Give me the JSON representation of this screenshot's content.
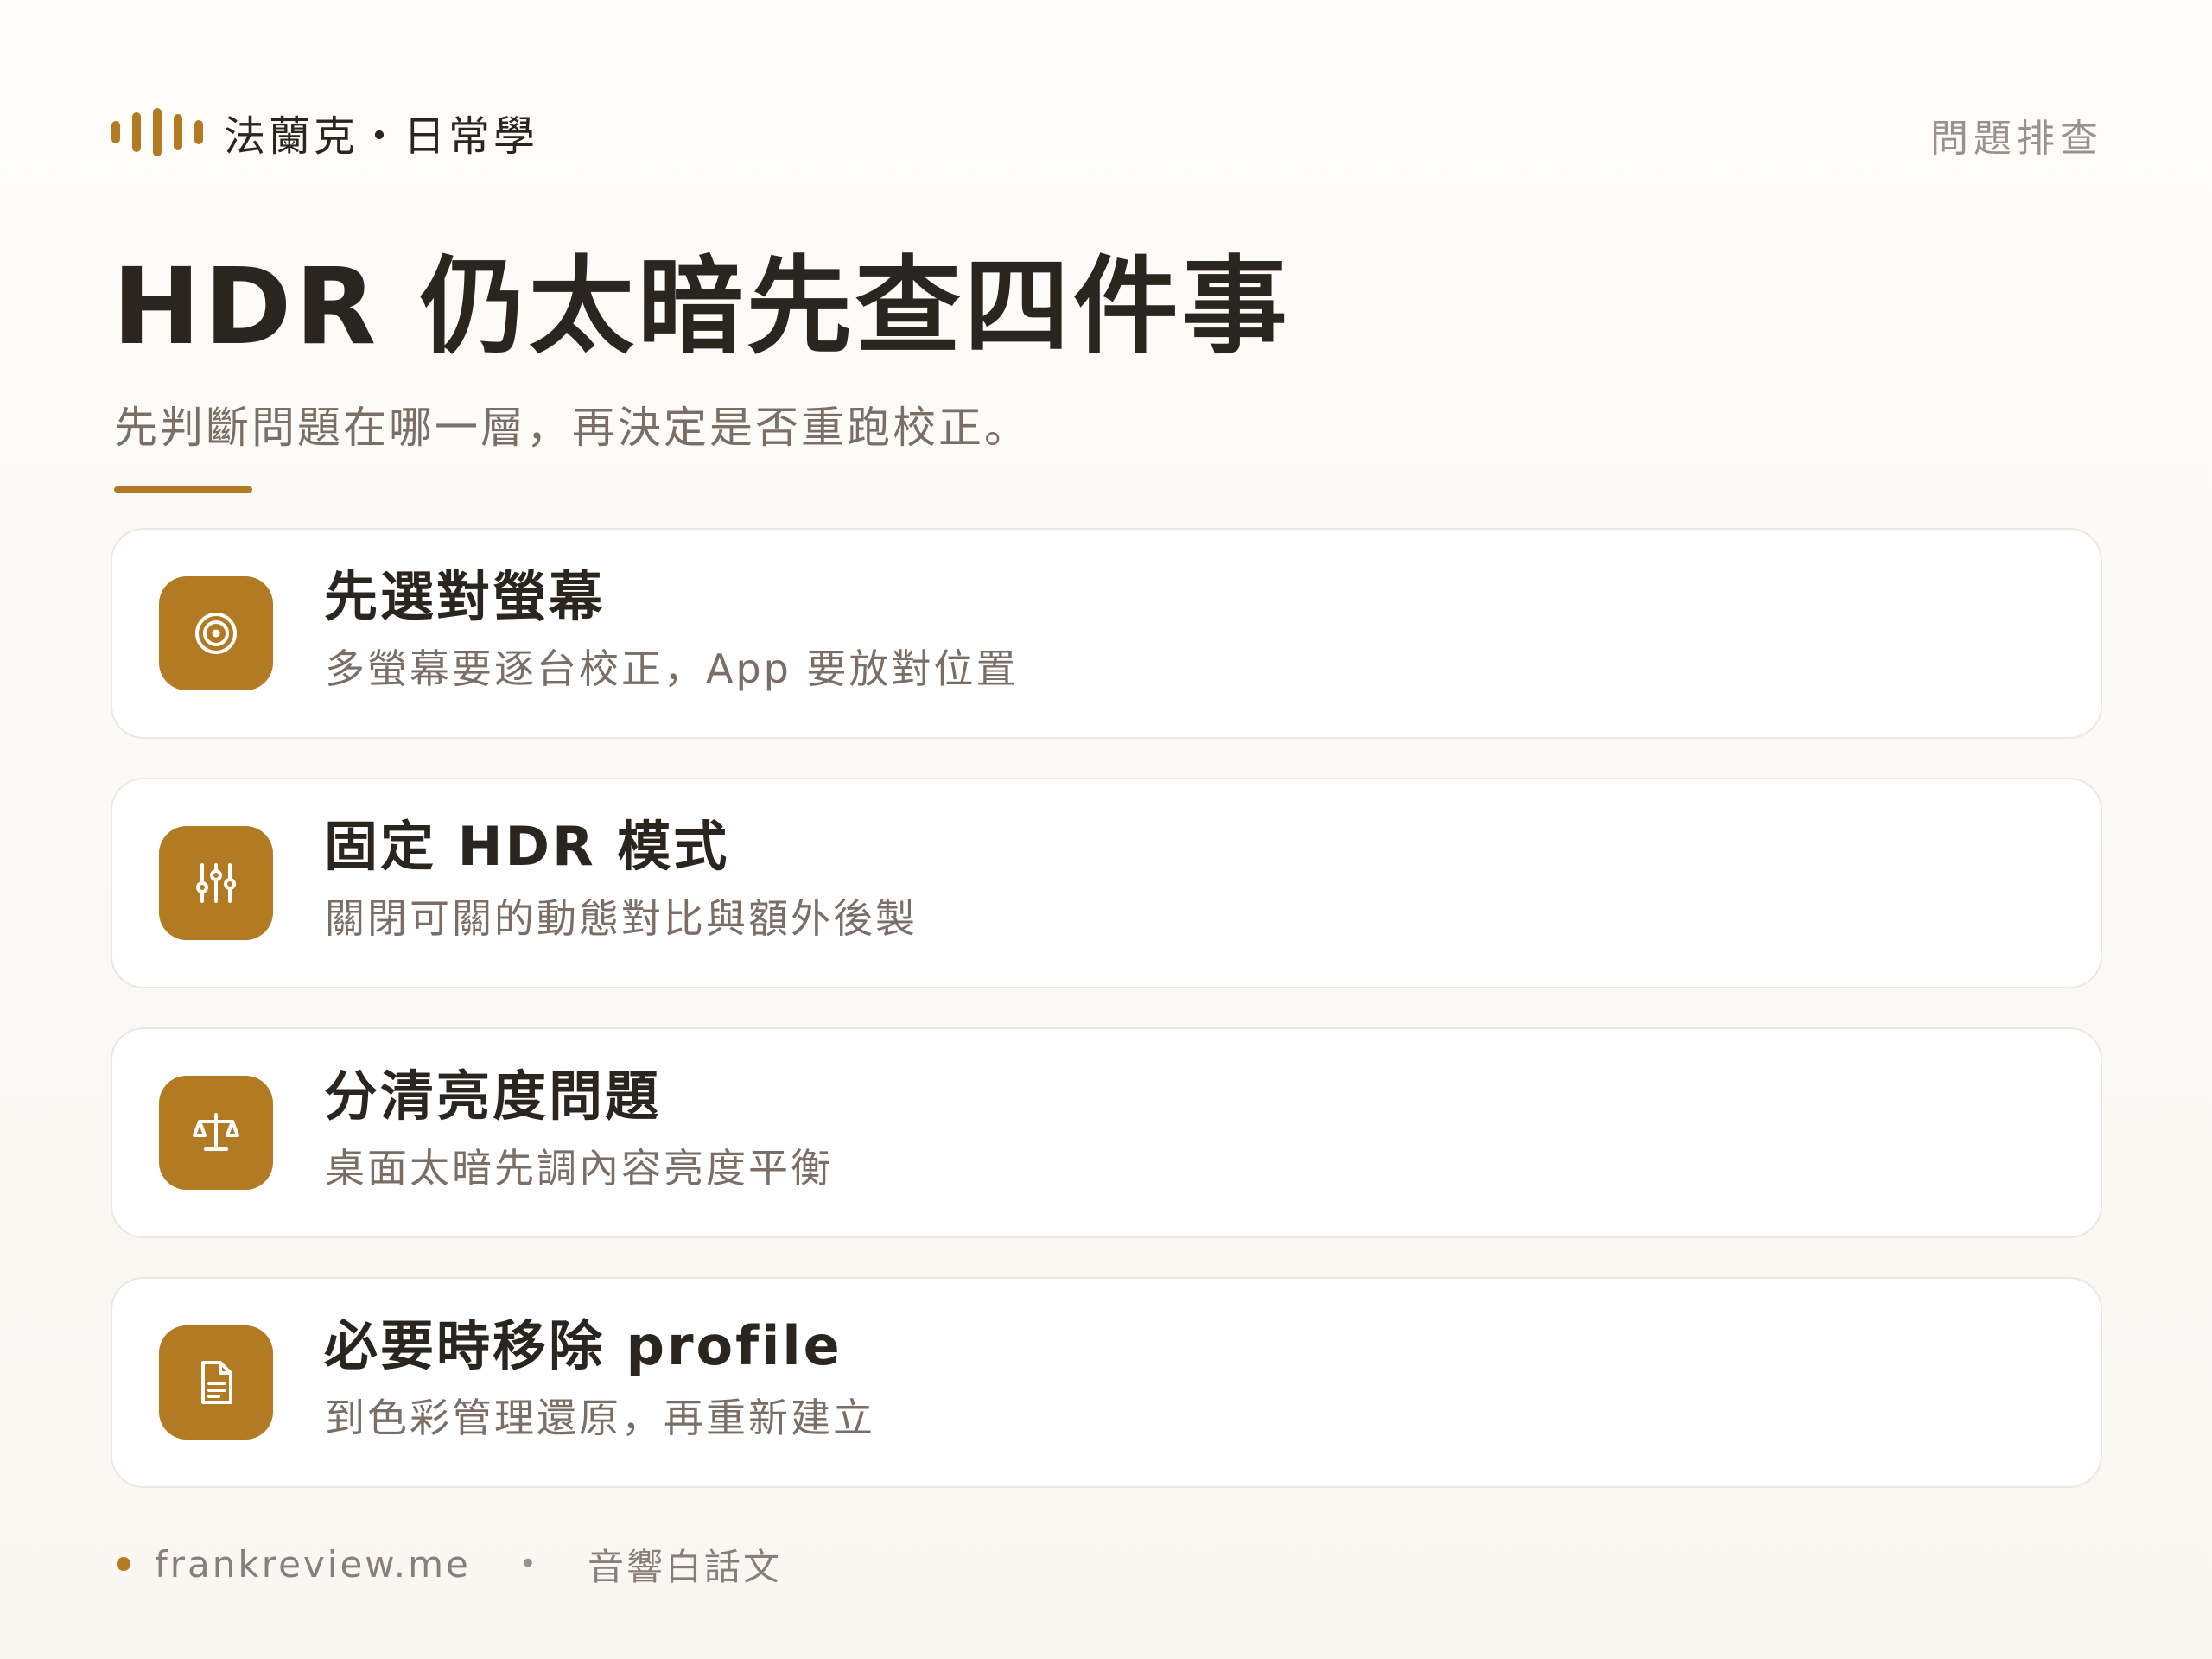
{
  "header": {
    "brand": "法蘭克・日常學",
    "brand_icon": "sound-wave-icon",
    "tag": "問題排查"
  },
  "main": {
    "title": "HDR 仍太暗先查四件事",
    "subtitle": "先判斷問題在哪一層，再決定是否重跑校正。",
    "cards": [
      {
        "icon": "target-icon",
        "title": "先選對螢幕",
        "desc": "多螢幕要逐台校正，App 要放對位置"
      },
      {
        "icon": "sliders-icon",
        "title": "固定 HDR 模式",
        "desc": "關閉可關的動態對比與額外後製"
      },
      {
        "icon": "scale-icon",
        "title": "分清亮度問題",
        "desc": "桌面太暗先調內容亮度平衡"
      },
      {
        "icon": "document-icon",
        "title": "必要時移除 profile",
        "desc": "到色彩管理還原，再重新建立"
      }
    ]
  },
  "footer": {
    "site": "frankreview.me",
    "separator": "•",
    "series": "音響白話文"
  },
  "colors": {
    "accent": "#b27a22",
    "text_primary": "#2b2520",
    "text_secondary": "#7a6e66",
    "background": "#faf7f2"
  }
}
